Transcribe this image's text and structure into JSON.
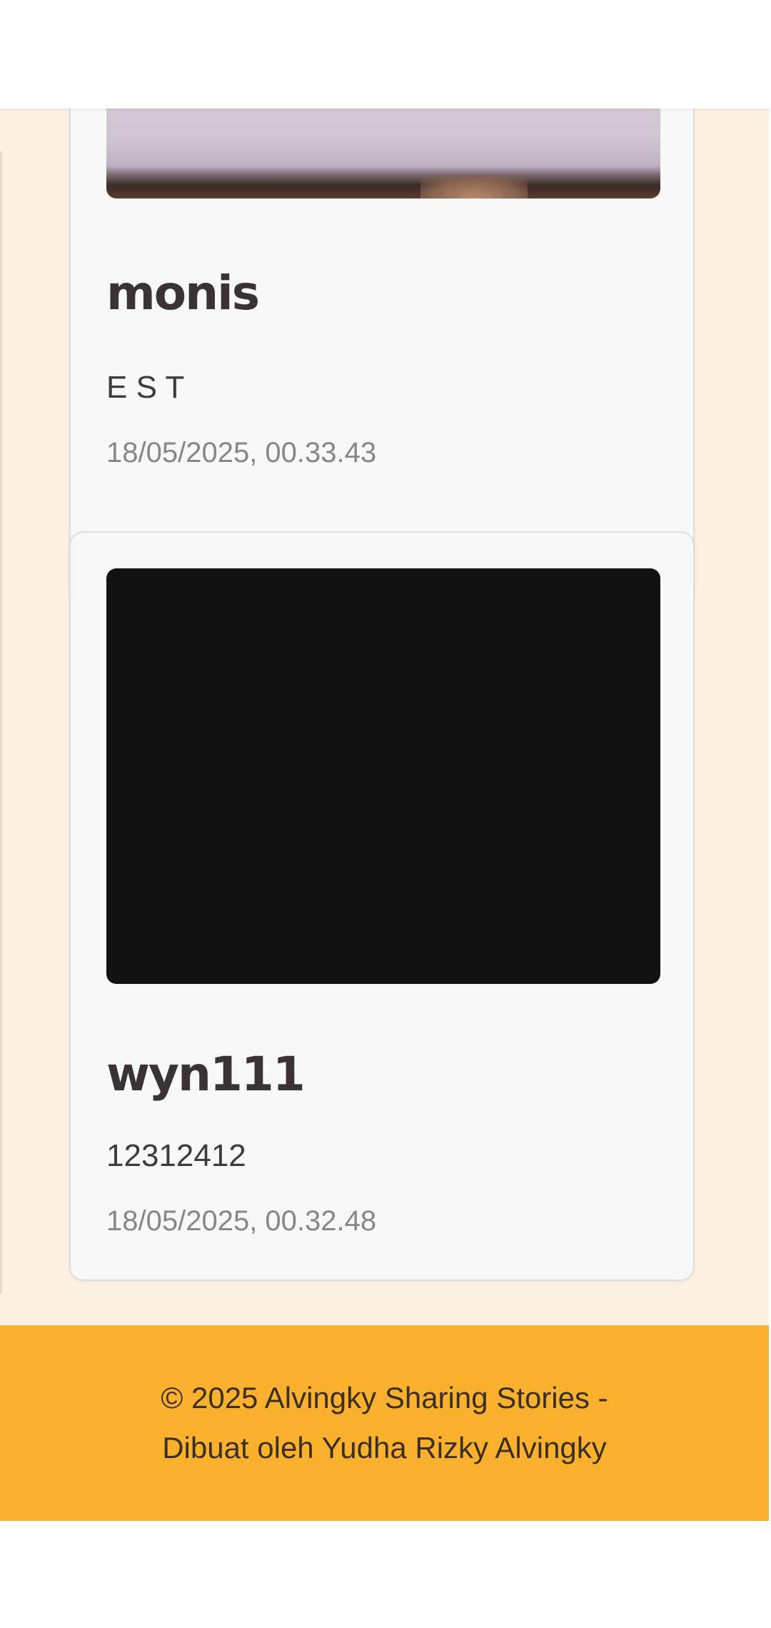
{
  "posts": [
    {
      "name": "monis",
      "description": "E S T",
      "timestamp": "18/05/2025, 00.33.43",
      "photo": "photo-partially-visible"
    },
    {
      "name": "wyn111",
      "description": "12312412",
      "timestamp": "18/05/2025, 00.32.48",
      "photo": "dark-photo"
    }
  ],
  "footer": {
    "line1": "© 2025 Alvingky Sharing Stories -",
    "line2": "Dibuat oleh Yudha Rizky Alvingky"
  },
  "colors": {
    "background": "#fdf1e3",
    "card": "#f8f8f8",
    "footer": "#fcb12e",
    "title": "#3a3335",
    "timestamp": "#8a8587"
  }
}
